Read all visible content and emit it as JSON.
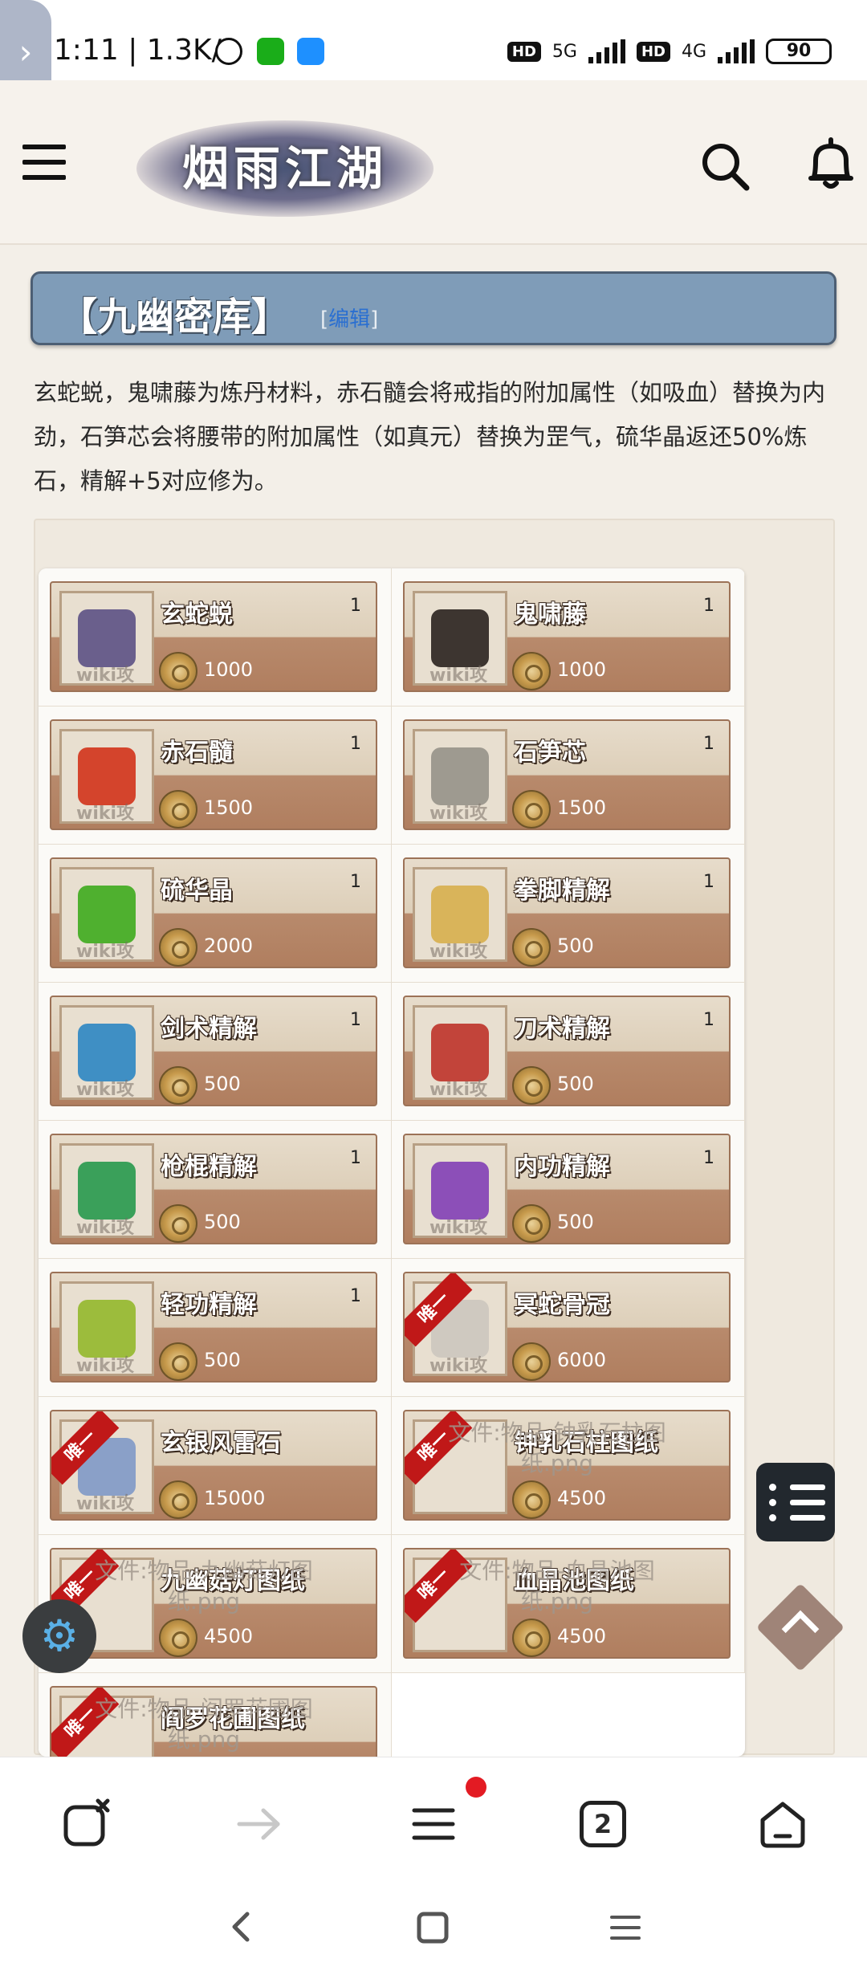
{
  "status_bar": {
    "time_speed": "11:11 | 1.3K/s",
    "net1": "5G",
    "net2": "4G",
    "hd": "HD",
    "battery": "90"
  },
  "header": {
    "logo_text": "烟雨江湖"
  },
  "section": {
    "title": "【九幽密库】",
    "edit_open": "[",
    "edit_label": "编辑",
    "edit_close": "]",
    "description": "玄蛇蜕，鬼啸藤为炼丹材料，赤石髓会将戒指的附加属性（如吸血）替换为内劲，石笋芯会将腰带的附加属性（如真元）替换为罡气，硫华晶返还50%炼石，精解+5对应修为。"
  },
  "watermark": "wiki攻略",
  "items": [
    {
      "name": "玄蛇蜕",
      "qty": "1",
      "price": "1000",
      "color": "#6a5f8c"
    },
    {
      "name": "鬼啸藤",
      "qty": "1",
      "price": "1000",
      "color": "#3d3530"
    },
    {
      "name": "赤石髓",
      "qty": "1",
      "price": "1500",
      "color": "#d4442c"
    },
    {
      "name": "石笋芯",
      "qty": "1",
      "price": "1500",
      "color": "#9e9a90"
    },
    {
      "name": "硫华晶",
      "qty": "1",
      "price": "2000",
      "color": "#4fb02f"
    },
    {
      "name": "拳脚精解",
      "qty": "1",
      "price": "500",
      "color": "#d9b45a"
    },
    {
      "name": "剑术精解",
      "qty": "1",
      "price": "500",
      "color": "#3f8fc4"
    },
    {
      "name": "刀术精解",
      "qty": "1",
      "price": "500",
      "color": "#c2443a"
    },
    {
      "name": "枪棍精解",
      "qty": "1",
      "price": "500",
      "color": "#3aa05a"
    },
    {
      "name": "内功精解",
      "qty": "1",
      "price": "500",
      "color": "#8c4fb8"
    },
    {
      "name": "轻功精解",
      "qty": "1",
      "price": "500",
      "color": "#9cbc3c"
    },
    {
      "name": "冥蛇骨冠",
      "qty": "",
      "price": "6000",
      "color": "#cfc9c0",
      "ribbon": "唯一"
    },
    {
      "name": "玄银风雷石",
      "qty": "",
      "price": "15000",
      "color": "#8aa0c8",
      "ribbon": "唯一"
    },
    {
      "name": "钟乳石柱图纸",
      "qty": "",
      "price": "4500",
      "color": "",
      "ribbon": "唯一",
      "file_text": "文件:物品-钟乳石柱图纸.png"
    },
    {
      "name": "九幽菇灯图纸",
      "qty": "",
      "price": "4500",
      "color": "",
      "ribbon": "唯一",
      "file_text": "文件:物品-九幽菇灯图纸.png"
    },
    {
      "name": "血晶池图纸",
      "qty": "",
      "price": "4500",
      "color": "",
      "ribbon": "唯一",
      "file_text": "文件:物品-血晶池图纸.png"
    },
    {
      "name": "阎罗花圃图纸",
      "qty": "",
      "price": "",
      "color": "",
      "ribbon": "唯一",
      "file_text": "文件:物品-阎罗花圃图纸.png"
    }
  ],
  "browser_bar": {
    "tab_count": "2"
  },
  "colors": {
    "title_bg": "#7f9cb8",
    "card_top": "#e7dccb",
    "card_bottom": "#b07e5f",
    "ribbon": "#c01818",
    "notify_dot": "#e31b23"
  }
}
